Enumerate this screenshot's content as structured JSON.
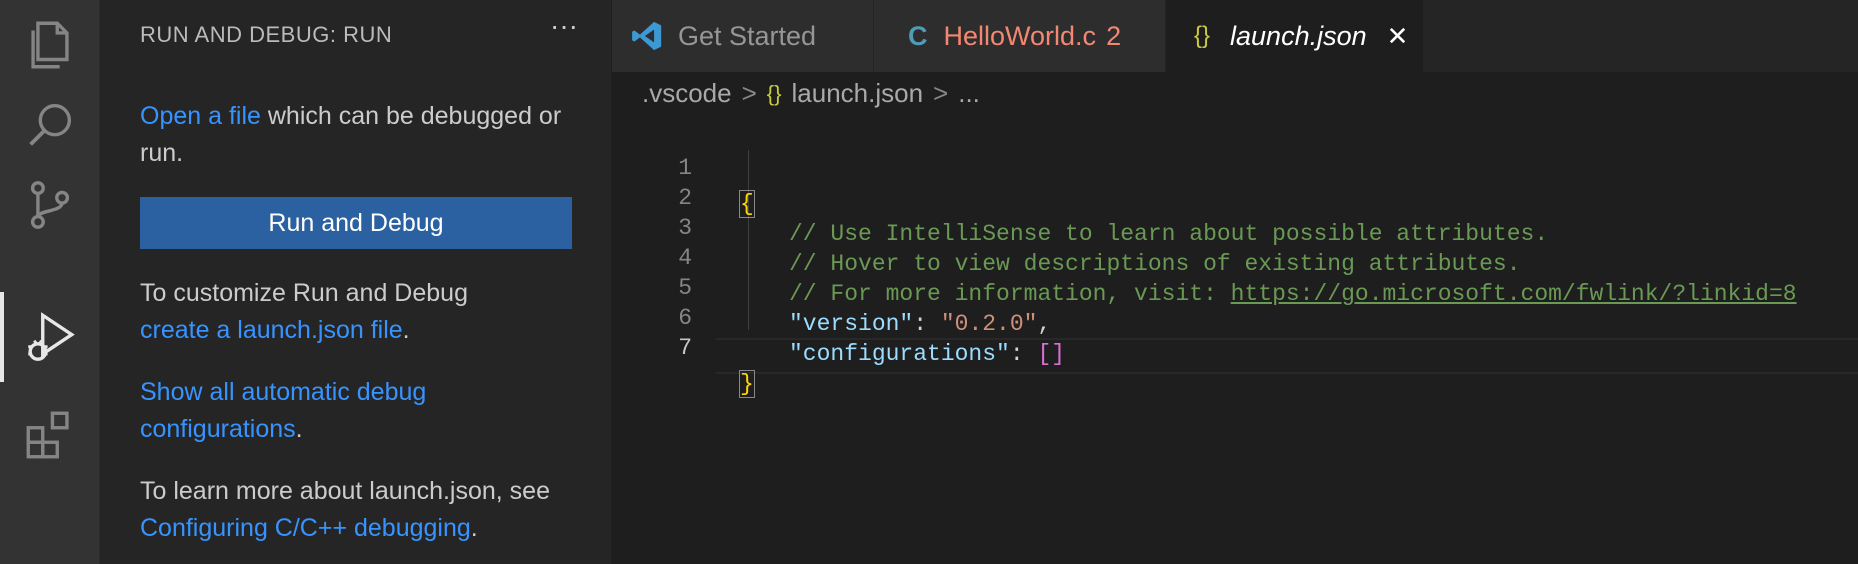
{
  "sidebar": {
    "header": "RUN AND DEBUG: RUN",
    "more": "···",
    "open_file_link": "Open a file",
    "open_file_rest": " which can be debugged or run.",
    "run_button": "Run and Debug",
    "customize_text": "To customize Run and Debug",
    "create_launch_link": "create a launch.json file",
    "period": ".",
    "show_all_link": "Show all automatic debug configurations",
    "learn_text": "To learn more about launch.json, see ",
    "configuring_link": "Configuring C/C++ debugging"
  },
  "activity": {
    "items": [
      "explorer-icon",
      "search-icon",
      "source-control-icon",
      "run-debug-icon",
      "extensions-icon"
    ],
    "active": "run-debug-icon"
  },
  "tabs": [
    {
      "label": "Get Started",
      "icon": "vscode-logo-icon"
    },
    {
      "label": "HelloWorld.c",
      "badge": "2",
      "icon": "c-file-icon",
      "icon_text": "C",
      "color": "#f48771"
    },
    {
      "label": "launch.json",
      "icon": "json-icon",
      "icon_text": "{}",
      "active": true,
      "close": "✕"
    }
  ],
  "breadcrumb": {
    "folder": ".vscode",
    "icon_text": "{}",
    "file": "launch.json",
    "ellipsis": "...",
    "sep": ">"
  },
  "editor": {
    "line_numbers": [
      "1",
      "2",
      "3",
      "4",
      "5",
      "6",
      "7"
    ],
    "open_brace": "{",
    "comment1": "// Use IntelliSense to learn about possible attributes.",
    "comment2": "// Hover to view descriptions of existing attributes.",
    "comment3_prefix": "// For more information, visit: ",
    "comment3_link": "https://go.microsoft.com/fwlink/?linkid=8",
    "version_key": "\"version\"",
    "version_val": "\"0.2.0\"",
    "config_key": "\"configurations\"",
    "config_val": "[]",
    "colon": ": ",
    "comma": ",",
    "close_brace": "}"
  },
  "colors": {
    "accent": "#2b61a0",
    "link": "#3794ff",
    "comment": "#6a9955",
    "string": "#ce9178",
    "key": "#9cdcfe",
    "error_tab": "#f48771"
  }
}
